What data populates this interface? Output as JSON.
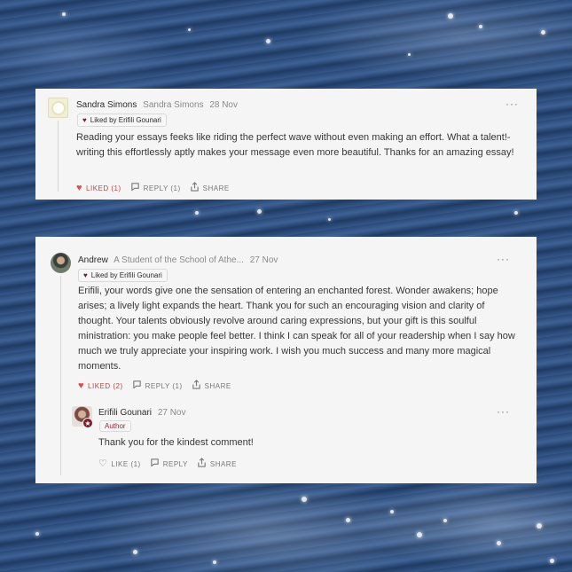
{
  "comments": [
    {
      "name": "Sandra Simons",
      "handle": "Sandra Simons",
      "date": "28 Nov",
      "liked_by": "Liked by Erifili Gounari",
      "body": "Reading your essays feeks like riding the perfect wave without even making an effort. What a talent!- writing this effortlessly aptly makes your message even more beautiful. Thanks for an amazing essay!",
      "like_label": "LIKED (1)",
      "reply_label": "REPLY (1)",
      "share_label": "SHARE"
    },
    {
      "name": "Andrew",
      "handle": "A Student of the School of Athe...",
      "date": "27 Nov",
      "liked_by": "Liked by Erifili Gounari",
      "body": "Erifili, your words give one the sensation of entering an enchanted forest. Wonder awakens; hope arises; a lively light expands the heart. Thank you for such an encouraging vision and clarity of thought. Your talents obviously revolve around caring expressions, but your gift is this soulful ministration: you make people feel better. I think I can speak for all of your readership when I say how much we truly appreciate your inspiring work. I wish you much success and many more magical moments.",
      "like_label": "LIKED (2)",
      "reply_label": "REPLY (1)",
      "share_label": "SHARE"
    },
    {
      "name": "Erifili Gounari",
      "date": "27 Nov",
      "badge": "Author",
      "body": "Thank you for the kindest comment!",
      "like_label": "LIKE (1)",
      "reply_label": "REPLY",
      "share_label": "SHARE"
    }
  ],
  "icons": {
    "heart_filled": "heart-filled-icon",
    "heart_outline": "heart-outline-icon",
    "reply": "speech-bubble-icon",
    "share": "share-icon",
    "more": "ellipsis-icon"
  },
  "colors": {
    "liked": "#c9433d",
    "author": "#7a1d2b",
    "card": "#f5f5f5"
  }
}
